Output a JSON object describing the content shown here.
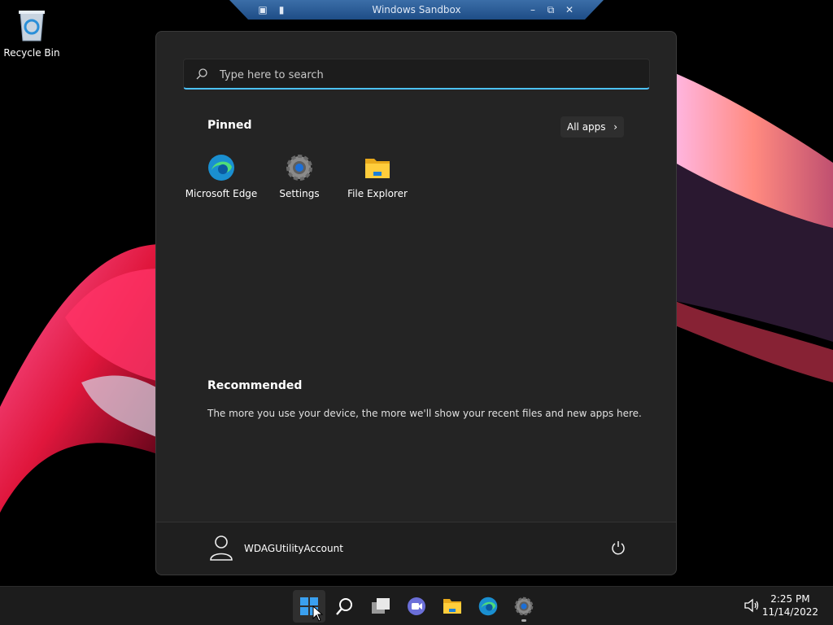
{
  "desktop": {
    "recycle_bin_label": "Recycle Bin"
  },
  "sandbox": {
    "title": "Windows Sandbox",
    "minimize": "–",
    "restore": "⧉",
    "close": "✕"
  },
  "start_menu": {
    "search_placeholder": "Type here to search",
    "pinned_title": "Pinned",
    "all_apps_label": "All apps",
    "pinned": [
      {
        "label": "Microsoft Edge",
        "icon": "edge-icon"
      },
      {
        "label": "Settings",
        "icon": "settings-gear-icon"
      },
      {
        "label": "File Explorer",
        "icon": "folder-icon"
      }
    ],
    "recommended_title": "Recommended",
    "recommended_text": "The more you use your device, the more we'll show your recent files and new apps here.",
    "user_name": "WDAGUtilityAccount"
  },
  "taskbar": {
    "items": [
      "start-button",
      "search-button",
      "task-view-button",
      "teams-chat-button",
      "file-explorer-button",
      "edge-button",
      "settings-button"
    ],
    "time": "2:25 PM",
    "date": "11/14/2022"
  },
  "colors": {
    "accent": "#4cc2ff",
    "menu_bg": "#242424",
    "taskbar_bg": "#1c1c1c"
  }
}
